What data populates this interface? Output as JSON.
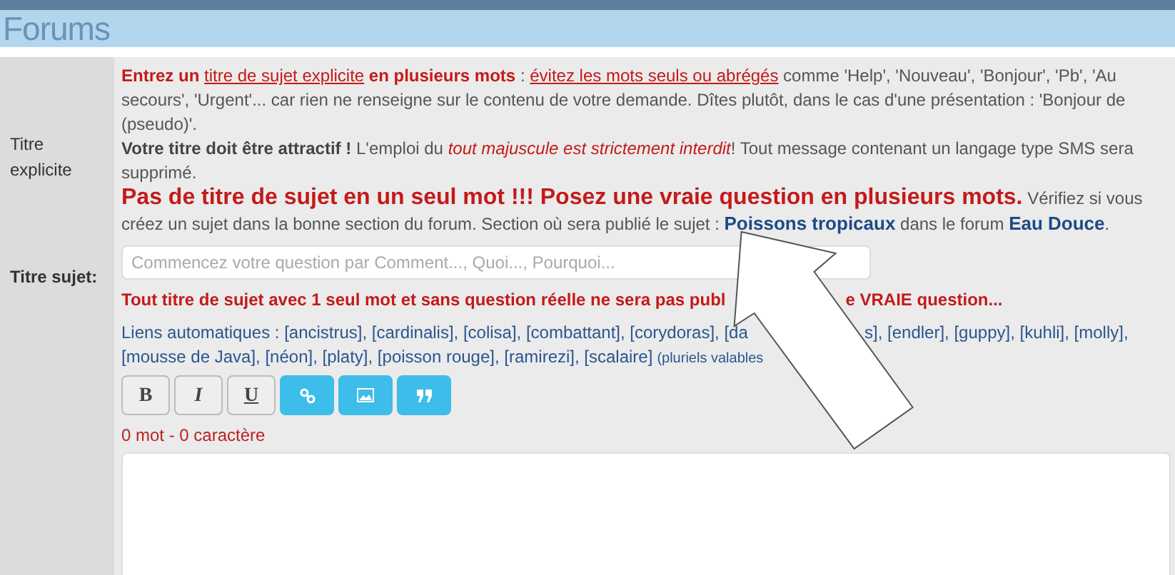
{
  "header": {
    "title": "Forums"
  },
  "explicit": {
    "label": "Titre explicite",
    "paragraphs": [
      [
        {
          "kind": "strong",
          "text": "Entrez un "
        },
        {
          "kind": "link",
          "text": "titre de sujet explicite"
        },
        {
          "kind": "strong",
          "text": " en plusieurs mots"
        },
        {
          "kind": "plain",
          "text": " : "
        },
        {
          "kind": "link",
          "text": "évitez les mots seuls ou abrégés"
        },
        {
          "kind": "plain",
          "text": " comme 'Help', 'Nouveau', 'Bonjour', 'Pb', 'Au secours', 'Urgent'... car rien ne renseigne sur le contenu de votre demande. Dîtes plutôt, dans le cas d'une présentation : 'Bonjour de (pseudo)'."
        }
      ],
      [
        {
          "kind": "bold",
          "text": "Votre titre doit être attractif !"
        },
        {
          "kind": "plain",
          "text": " L'emploi du "
        },
        {
          "kind": "emph",
          "text": "tout majuscule est strictement interdit"
        },
        {
          "kind": "plain",
          "text": "! Tout message contenant un langage type SMS sera supprimé."
        }
      ],
      [
        {
          "kind": "big",
          "text": "Pas de titre de sujet en un seul mot !!! Posez une vraie question en plusieurs mots."
        },
        {
          "kind": "plain",
          "text": " Vérifiez si vous créez un sujet dans la bonne section du forum. Section où sera publié le sujet : "
        },
        {
          "kind": "highlight",
          "text": "Poissons tropicaux"
        },
        {
          "kind": "plain",
          "text": " dans le forum "
        },
        {
          "kind": "highlight",
          "text": "Eau Douce"
        },
        {
          "kind": "plain",
          "text": "."
        }
      ]
    ]
  },
  "subject": {
    "label": "Titre sujet:",
    "placeholder": "Commencez votre question par Comment..., Quoi..., Pourquoi...",
    "warning": [
      "Tout titre de sujet avec 1 seul mot et sans question réelle ne sera pas publ",
      "e VRAIE question..."
    ],
    "auto_links": [
      [
        "Liens automatiques : [ancistrus], [cardinalis], [colisa], [combattant], [corydoras], [da",
        "s], [endler], [guppy], [kuhli], [molly],"
      ],
      [
        "[mousse de Java], [néon], [platy], [poisson rouge], [ramirezi], [scalaire]"
      ]
    ],
    "auto_links_note": "(pluriels valables",
    "toolbar": [
      {
        "kind": "bold",
        "label": "B"
      },
      {
        "kind": "italic",
        "label": "I"
      },
      {
        "kind": "underline",
        "label": "U"
      },
      {
        "kind": "link"
      },
      {
        "kind": "image"
      },
      {
        "kind": "quote"
      }
    ],
    "counter": "0 mot - 0 caractère"
  },
  "annotation": {
    "kind": "arrow"
  }
}
